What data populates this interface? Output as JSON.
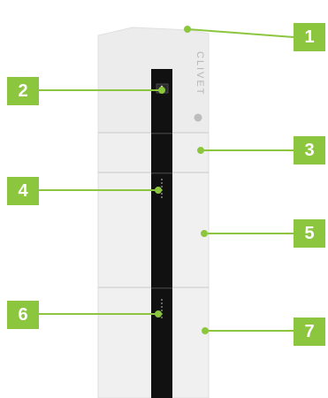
{
  "brand": "CLIVET",
  "accent_color": "#8cc63f",
  "callouts": [
    {
      "label": "1"
    },
    {
      "label": "2"
    },
    {
      "label": "3"
    },
    {
      "label": "4"
    },
    {
      "label": "5"
    },
    {
      "label": "6"
    },
    {
      "label": "7"
    }
  ]
}
